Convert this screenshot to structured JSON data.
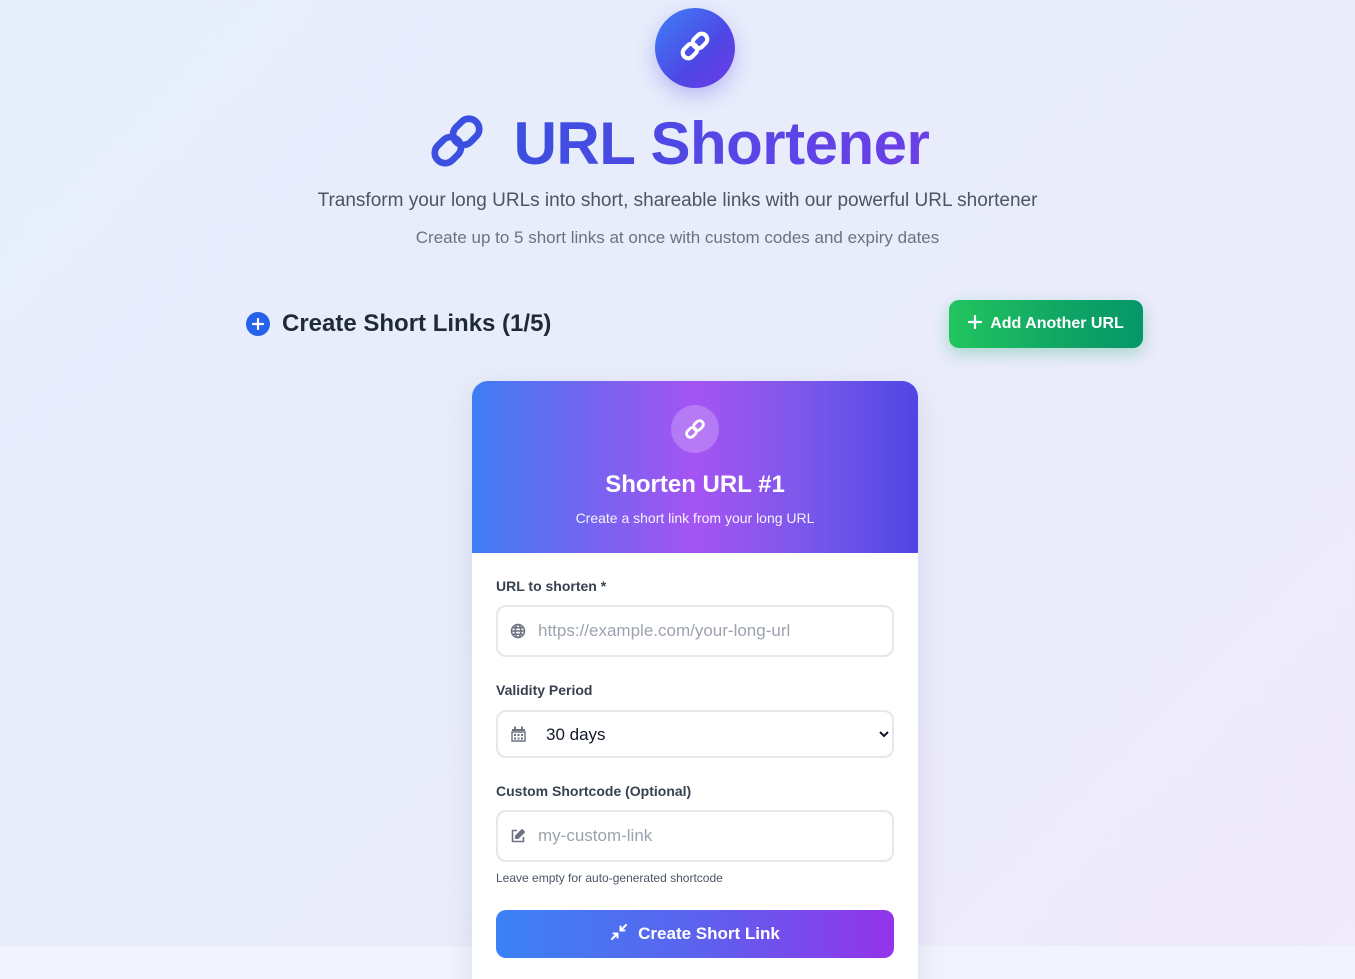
{
  "header": {
    "logo_icon": "link-icon",
    "title_icon": "link-icon",
    "title": "URL Shortener",
    "subtitle": "Transform your long URLs into short, shareable links with our powerful URL shortener",
    "subtitle2": "Create up to 5 short links at once with custom codes and expiry dates"
  },
  "section": {
    "icon": "plus-circle-icon",
    "title": "Create Short Links (1/5)",
    "add_button_label": "Add Another URL",
    "add_button_icon": "plus-icon"
  },
  "card": {
    "icon": "link-icon",
    "title": "Shorten URL #1",
    "subtitle": "Create a short link from your long URL",
    "url_label": "URL to shorten *",
    "url_icon": "globe-icon",
    "url_placeholder": "https://example.com/your-long-url",
    "url_value": "",
    "validity_label": "Validity Period",
    "validity_icon": "calendar-icon",
    "validity_selected": "30 days",
    "shortcode_label": "Custom Shortcode (Optional)",
    "shortcode_icon": "edit-icon",
    "shortcode_placeholder": "my-custom-link",
    "shortcode_value": "",
    "shortcode_hint": "Leave empty for auto-generated shortcode",
    "create_button_label": "Create Short Link",
    "create_button_icon": "compress-icon"
  },
  "colors": {
    "primary_blue": "#3b82f6",
    "indigo": "#4f46e5",
    "purple": "#9333ea",
    "green": "#22c55e",
    "green_dark": "#059669"
  }
}
